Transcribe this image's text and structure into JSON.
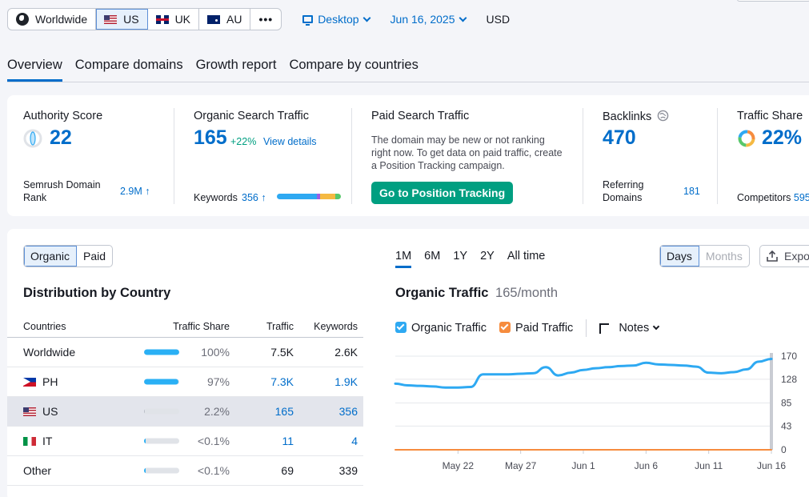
{
  "topbar": {
    "regions": [
      {
        "label": "Worldwide",
        "flag": "globe"
      },
      {
        "label": "US",
        "flag": "us"
      },
      {
        "label": "UK",
        "flag": "uk"
      },
      {
        "label": "AU",
        "flag": "au"
      }
    ],
    "selected_region": "US",
    "more_label": "•••",
    "device": "Desktop",
    "date": "Jun 16, 2025",
    "currency": "USD"
  },
  "tabs": [
    "Overview",
    "Compare domains",
    "Growth report",
    "Compare by countries"
  ],
  "active_tab": "Overview",
  "summary": {
    "authority": {
      "title": "Authority Score",
      "value": "22",
      "rank_label": "Semrush Domain Rank",
      "rank_value": "2.9M ↑"
    },
    "organic": {
      "title": "Organic Search Traffic",
      "value": "165",
      "change": "+22%",
      "details_link": "View details",
      "keywords_label": "Keywords",
      "keywords_value": "356 ↑"
    },
    "paid": {
      "title": "Paid Search Traffic",
      "message": "The domain may be new or not ranking right now. To get data on paid traffic, create a Position Tracking campaign.",
      "button": "Go to Position Tracking"
    },
    "backlinks": {
      "title": "Backlinks",
      "value": "470",
      "referring_label": "Referring Domains",
      "referring_value": "181"
    },
    "traffic_share": {
      "title": "Traffic Share",
      "value": "22%",
      "competitors_label": "Competitors",
      "competitors_value": "595"
    }
  },
  "distribution": {
    "toggle": [
      "Organic",
      "Paid"
    ],
    "toggle_active": "Organic",
    "title": "Distribution by Country",
    "headers": {
      "countries": "Countries",
      "share": "Traffic Share",
      "traffic": "Traffic",
      "keywords": "Keywords"
    },
    "rows": [
      {
        "country": "Worldwide",
        "flag": "",
        "share": "100%",
        "share_pct": 100,
        "traffic": "7.5K",
        "keywords": "2.6K",
        "link": false,
        "highlight": false
      },
      {
        "country": "PH",
        "flag": "ph",
        "share": "97%",
        "share_pct": 97,
        "traffic": "7.3K",
        "keywords": "1.9K",
        "link": true,
        "highlight": false
      },
      {
        "country": "US",
        "flag": "us",
        "share": "2.2%",
        "share_pct": 2.2,
        "traffic": "165",
        "keywords": "356",
        "link": true,
        "highlight": true
      },
      {
        "country": "IT",
        "flag": "it",
        "share": "<0.1%",
        "share_pct": 0.1,
        "traffic": "11",
        "keywords": "4",
        "link": true,
        "highlight": false
      },
      {
        "country": "Other",
        "flag": "",
        "share": "<0.1%",
        "share_pct": 0.1,
        "traffic": "69",
        "keywords": "339",
        "link": false,
        "highlight": false
      }
    ]
  },
  "chart_panel": {
    "periods": [
      "1M",
      "6M",
      "1Y",
      "2Y",
      "All time"
    ],
    "active_period": "1M",
    "granularity": [
      "Days",
      "Months"
    ],
    "granularity_active": "Days",
    "export_label": "Expo",
    "title": "Organic Traffic",
    "subtitle": "165/month",
    "legend": [
      {
        "label": "Organic Traffic",
        "color": "#2ea9f2",
        "checked": true
      },
      {
        "label": "Paid Traffic",
        "color": "#f68c3e",
        "checked": true
      }
    ],
    "notes_label": "Notes"
  },
  "chart_data": {
    "type": "line",
    "x": [
      "May 17",
      "May 18",
      "May 19",
      "May 20",
      "May 21",
      "May 22",
      "May 23",
      "May 24",
      "May 25",
      "May 26",
      "May 27",
      "May 28",
      "May 29",
      "May 30",
      "May 31",
      "Jun 1",
      "Jun 2",
      "Jun 3",
      "Jun 4",
      "Jun 5",
      "Jun 6",
      "Jun 7",
      "Jun 8",
      "Jun 9",
      "Jun 10",
      "Jun 11",
      "Jun 12",
      "Jun 13",
      "Jun 14",
      "Jun 15",
      "Jun 16"
    ],
    "series": [
      {
        "name": "Organic Traffic",
        "color": "#2ea9f2",
        "values": [
          120,
          117,
          116,
          115,
          113,
          113,
          114,
          137,
          137,
          137,
          138,
          139,
          150,
          135,
          140,
          145,
          148,
          150,
          152,
          153,
          158,
          155,
          154,
          153,
          151,
          140,
          139,
          141,
          146,
          160,
          165
        ]
      },
      {
        "name": "Paid Traffic",
        "color": "#f68c3e",
        "values": [
          0,
          0,
          0,
          0,
          0,
          0,
          0,
          0,
          0,
          0,
          0,
          0,
          0,
          0,
          0,
          0,
          0,
          0,
          0,
          0,
          0,
          0,
          0,
          0,
          0,
          0,
          0,
          0,
          0,
          0,
          0
        ]
      }
    ],
    "x_tick_labels": [
      "May 22",
      "May 27",
      "Jun 1",
      "Jun 6",
      "Jun 11",
      "Jun 16"
    ],
    "y_ticks": [
      0,
      43,
      85,
      128,
      170
    ],
    "ylim": [
      0,
      170
    ],
    "grid": true
  }
}
